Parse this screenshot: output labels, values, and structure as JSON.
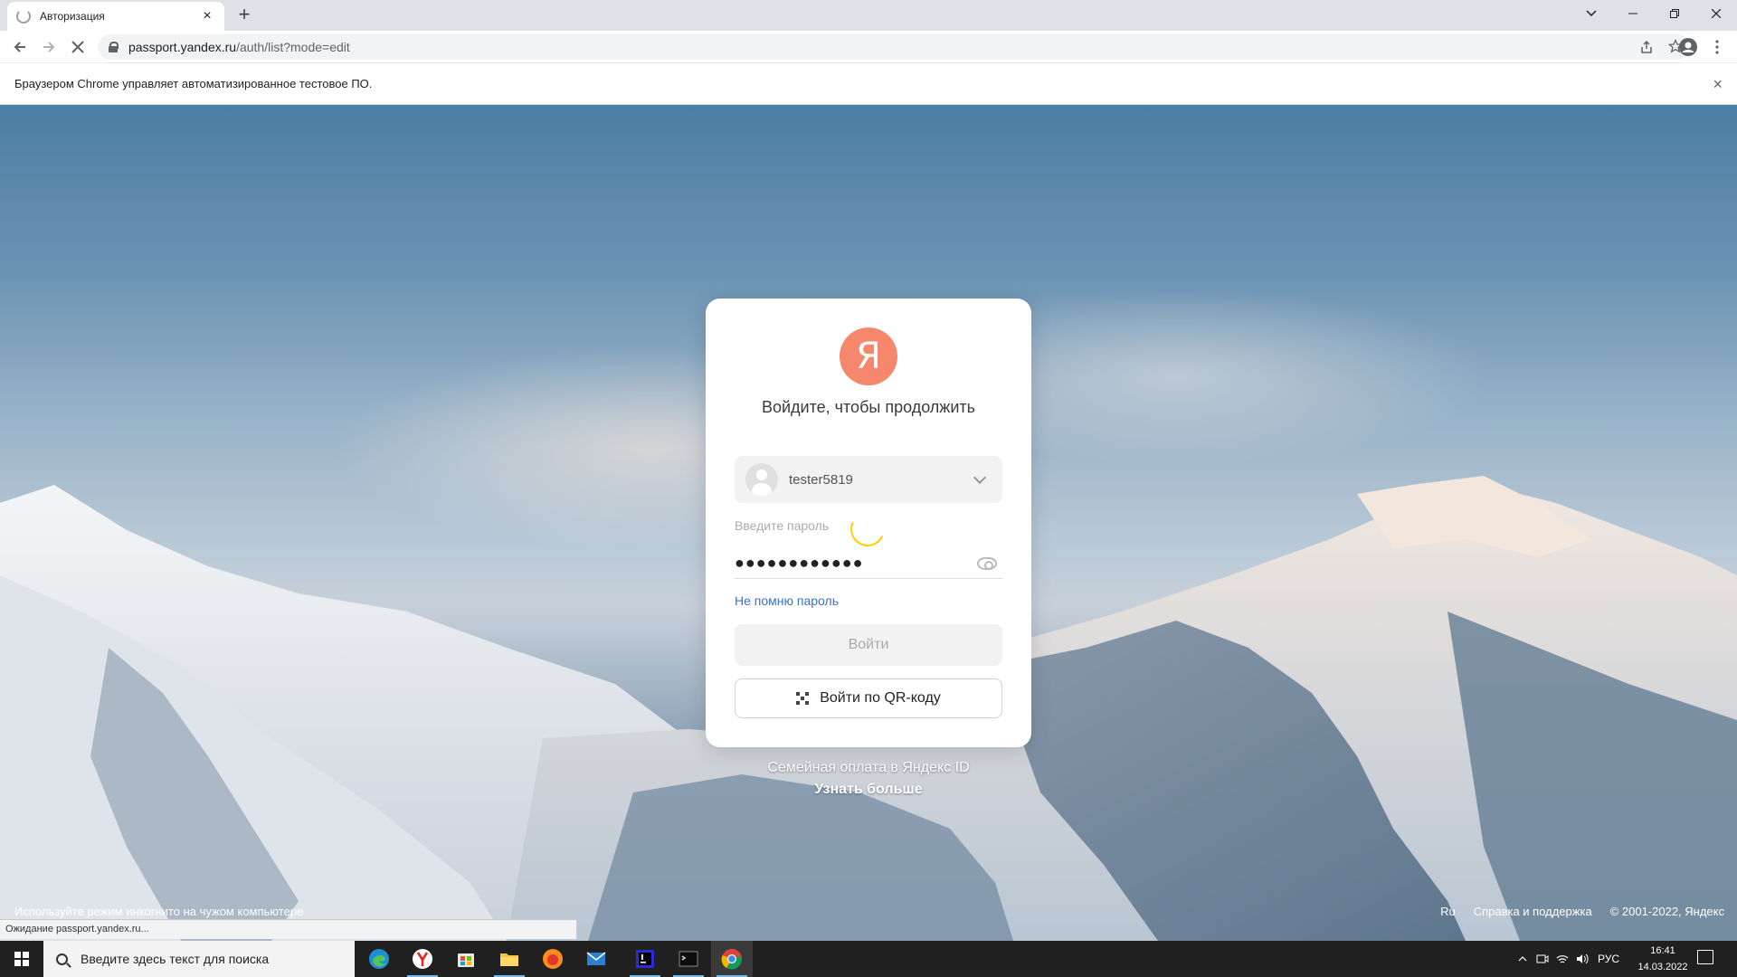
{
  "browser": {
    "tab_title": "Авторизация",
    "tab_close": "×",
    "new_tab": "+",
    "url_host": "passport.yandex.ru",
    "url_path": "/auth/list?mode=edit",
    "infobar_text": "Браузером Chrome управляет автоматизированное тестовое ПО.",
    "infobar_close": "×",
    "status_text": "Ожидание passport.yandex.ru..."
  },
  "card": {
    "logo_letter": "Я",
    "title": "Войдите, чтобы продолжить",
    "account_login": "tester5819",
    "password_label": "Введите пароль",
    "password_value": "●●●●●●●●●●●●",
    "forgot_link": "Не помню пароль",
    "login_button": "Войти",
    "qr_button": "Войти по QR-коду"
  },
  "promo": {
    "line1": "Семейная оплата в Яндекс ID",
    "line2": "Узнать больше"
  },
  "footer": {
    "incognito_tip": "Используйте режим инкогнито на чужом компьютере",
    "lang": "Ru",
    "help": "Справка и поддержка",
    "copyright": "© 2001-2022, Яндекс"
  },
  "taskbar": {
    "search_placeholder": "Введите здесь текст для поиска",
    "lang_indicator": "РУС",
    "time": "16:41",
    "date": "14.03.2022",
    "apps": [
      "edge-icon",
      "yandex-browser-icon",
      "store-icon",
      "file-explorer-icon",
      "firefox-icon",
      "mail-icon",
      "intellij-icon",
      "terminal-icon",
      "chrome-icon"
    ]
  },
  "colors": {
    "yandex_logo": "#f6876c",
    "link": "#3a72c3",
    "spinner": "#ffcc00"
  }
}
